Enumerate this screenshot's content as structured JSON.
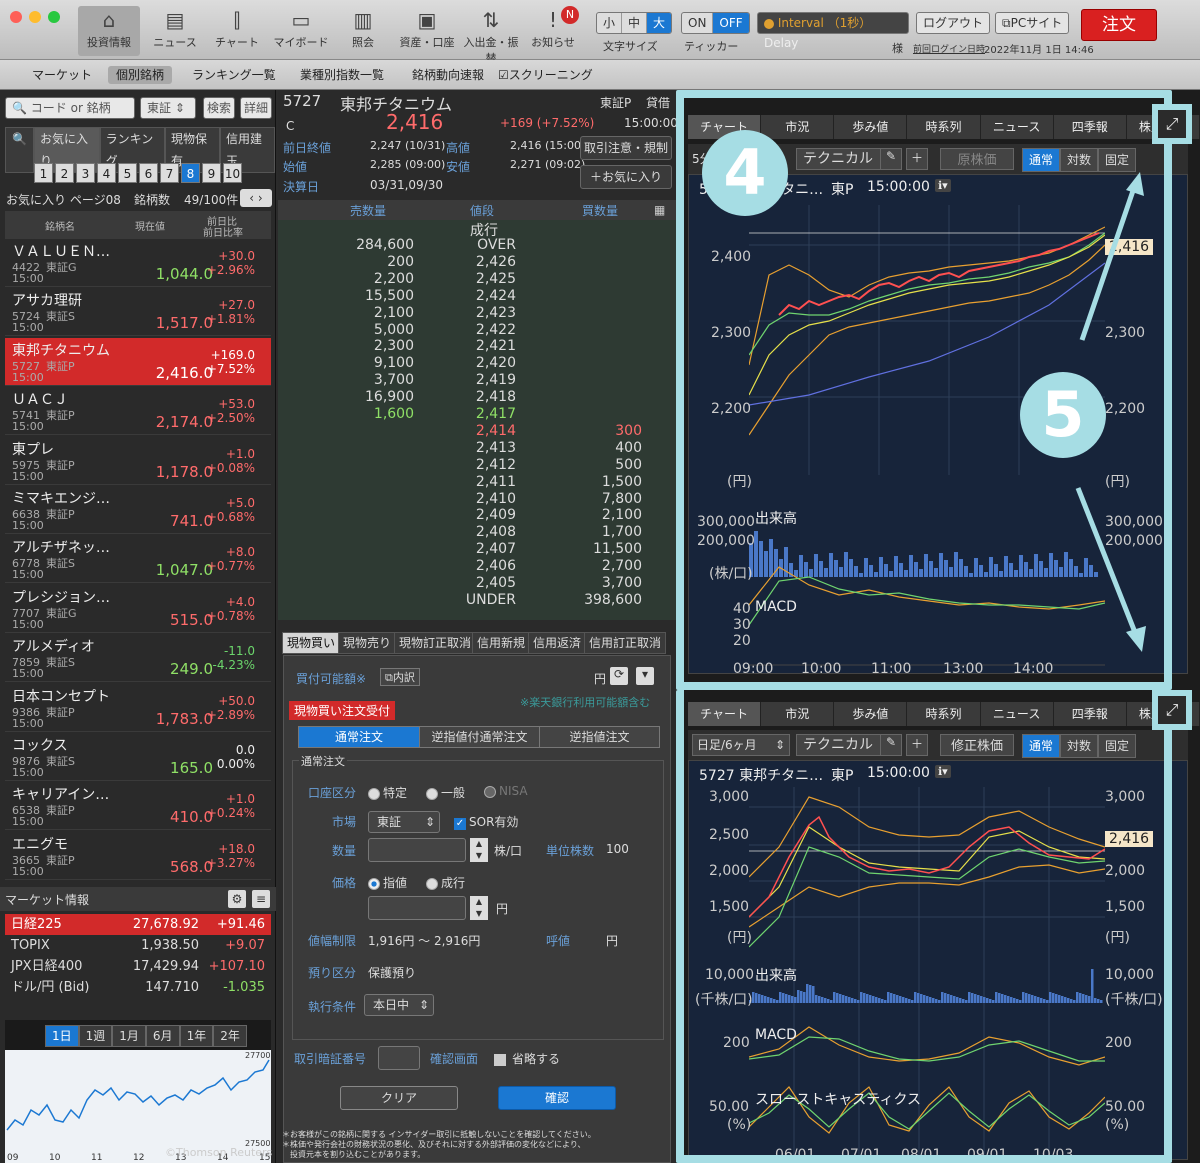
{
  "toolbar": {
    "buttons": [
      {
        "label": "投資情報",
        "icon": "home-icon",
        "glyph": "⌂"
      },
      {
        "label": "ニュース",
        "icon": "news-icon",
        "glyph": "▤"
      },
      {
        "label": "チャート",
        "icon": "candlestick-icon",
        "glyph": "⫿"
      },
      {
        "label": "マイボード",
        "icon": "myboard-icon",
        "glyph": "▭"
      },
      {
        "label": "照会",
        "icon": "book-icon",
        "glyph": "▥"
      },
      {
        "label": "資産・口座",
        "icon": "safe-icon",
        "glyph": "▣"
      },
      {
        "label": "入出金・振替",
        "icon": "transfer-icon",
        "glyph": "⇅"
      },
      {
        "label": "お知らせ",
        "icon": "notice-icon",
        "glyph": "!"
      }
    ],
    "notice_badge": "N",
    "font_size": {
      "options": [
        "小",
        "中",
        "大"
      ],
      "selected": "大",
      "label": "文字サイズ"
    },
    "ticker": {
      "options": [
        "ON",
        "OFF"
      ],
      "selected": "OFF",
      "label": "ティッカー"
    },
    "interval": {
      "label": "Interval",
      "sub": "（1秒）",
      "delay": "Delay"
    },
    "logout": "ログアウト",
    "pc_site": "PCサイト",
    "order": "注文",
    "user_suffix": "様",
    "last_login_label": "前回ログイン日時",
    "last_login": "2022年11月 1日 14:46"
  },
  "submenu": [
    "マーケット",
    "個別銘柄",
    "ランキング一覧",
    "業種別指数一覧",
    "銘柄動向速報",
    "☑スクリーニング"
  ],
  "submenu_selected": 1,
  "left": {
    "search_placeholder": "コード or 銘柄",
    "market": "東証",
    "search_btn": "検索",
    "detail_btn": "詳細",
    "tabs": [
      "お気に入り",
      "ランキング",
      "現物保有",
      "信用建玉"
    ],
    "pages": [
      "1",
      "2",
      "3",
      "4",
      "5",
      "6",
      "7",
      "8",
      "9",
      "10"
    ],
    "page_selected": 7,
    "fav_title": "お気に入り ページ08",
    "count_label": "銘柄数",
    "count": "49/100件",
    "col_name": "銘柄名",
    "col_price": "現在値",
    "col_change": "前日比",
    "col_change2": "前日比率",
    "stocks": [
      {
        "name": "ＶＡＬＵＥＮ…",
        "code": "4422",
        "mkt": "東証G",
        "time": "15:00",
        "price": "1,044.0",
        "chg": "+30.0",
        "pct": "+2.96%",
        "dir": "pos",
        "pcolor": "grn"
      },
      {
        "name": "アサカ理研",
        "code": "5724",
        "mkt": "東証S",
        "time": "15:00",
        "price": "1,517.0",
        "chg": "+27.0",
        "pct": "+1.81%",
        "dir": "pos",
        "pcolor": "pos"
      },
      {
        "name": "東邦チタニウム",
        "code": "5727",
        "mkt": "東証P",
        "time": "15:00",
        "price": "2,416.0",
        "chg": "+169.0",
        "pct": "+7.52%",
        "dir": "pos",
        "pcolor": "pos"
      },
      {
        "name": "ＵＡＣＪ",
        "code": "5741",
        "mkt": "東証P",
        "time": "15:00",
        "price": "2,174.0",
        "chg": "+53.0",
        "pct": "+2.50%",
        "dir": "pos",
        "pcolor": "pos"
      },
      {
        "name": "東プレ",
        "code": "5975",
        "mkt": "東証P",
        "time": "15:00",
        "price": "1,178.0",
        "chg": "+1.0",
        "pct": "+0.08%",
        "dir": "pos",
        "pcolor": "pos"
      },
      {
        "name": "ミマキエンジ…",
        "code": "6638",
        "mkt": "東証P",
        "time": "15:00",
        "price": "741.0",
        "chg": "+5.0",
        "pct": "+0.68%",
        "dir": "pos",
        "pcolor": "pos"
      },
      {
        "name": "アルチザネッ…",
        "code": "6778",
        "mkt": "東証S",
        "time": "15:00",
        "price": "1,047.0",
        "chg": "+8.0",
        "pct": "+0.77%",
        "dir": "pos",
        "pcolor": "grn"
      },
      {
        "name": "プレシジョン…",
        "code": "7707",
        "mkt": "東証G",
        "time": "15:00",
        "price": "515.0",
        "chg": "+4.0",
        "pct": "+0.78%",
        "dir": "pos",
        "pcolor": "pos"
      },
      {
        "name": "アルメディオ",
        "code": "7859",
        "mkt": "東証S",
        "time": "15:00",
        "price": "249.0",
        "chg": "-11.0",
        "pct": "-4.23%",
        "dir": "neg",
        "pcolor": "grn"
      },
      {
        "name": "日本コンセプト",
        "code": "9386",
        "mkt": "東証P",
        "time": "15:00",
        "price": "1,783.0",
        "chg": "+50.0",
        "pct": "+2.89%",
        "dir": "pos",
        "pcolor": "pos"
      },
      {
        "name": "コックス",
        "code": "9876",
        "mkt": "東証S",
        "time": "15:00",
        "price": "165.0",
        "chg": "0.0",
        "pct": "0.00%",
        "dir": "wht",
        "pcolor": "grn"
      },
      {
        "name": "キャリアイン…",
        "code": "6538",
        "mkt": "東証P",
        "time": "15:00",
        "price": "410.0",
        "chg": "+1.0",
        "pct": "+0.24%",
        "dir": "pos",
        "pcolor": "pos"
      },
      {
        "name": "エニグモ",
        "code": "3665",
        "mkt": "東証P",
        "time": "15:00",
        "price": "568.0",
        "chg": "+18.0",
        "pct": "+3.27%",
        "dir": "pos",
        "pcolor": "pos"
      }
    ],
    "market_title": "マーケット情報",
    "markets": [
      {
        "name": "日経225",
        "value": "27,678.92",
        "chg": "+91.46"
      },
      {
        "name": "TOPIX",
        "value": "1,938.50",
        "chg": "+9.07"
      },
      {
        "name": "JPX日経400",
        "value": "17,429.94",
        "chg": "+107.10"
      },
      {
        "name": "ドル/円 (Bid)",
        "value": "147.710",
        "chg": "-1.035"
      }
    ],
    "periods": [
      "1日",
      "1週",
      "1月",
      "6月",
      "1年",
      "2年"
    ],
    "period_selected": 0,
    "mini_y": [
      "27700",
      "27500"
    ],
    "mini_x": [
      "09",
      "10",
      "11",
      "12",
      "13",
      "14",
      "15"
    ],
    "copyright": "©Thomson Reuters"
  },
  "mid": {
    "code": "5727",
    "name": "東邦チタニウム",
    "market": "東証P",
    "margin": "貸借",
    "mark": "C",
    "price": "2,416",
    "change": "+169 (+7.52%)",
    "time": "15:00:00",
    "prev_close_label": "前日終値",
    "prev_close": "2,247 (10/31)",
    "high_label": "高値",
    "high": "2,416 (15:00)",
    "open_label": "始値",
    "open": "2,285 (09:00)",
    "low_label": "安値",
    "low": "2,271 (09:02)",
    "settle_label": "決算日",
    "settle": "03/31,09/30",
    "caution": "取引注意・規制",
    "fav_add": "＋お気に入り",
    "ob_headers": [
      "売数量",
      "値段",
      "買数量"
    ],
    "ob_top": "成行",
    "orderbook": [
      {
        "sell": "284,600",
        "price": "OVER",
        "buy": ""
      },
      {
        "sell": "200",
        "price": "2,426",
        "buy": ""
      },
      {
        "sell": "2,200",
        "price": "2,425",
        "buy": ""
      },
      {
        "sell": "15,500",
        "price": "2,424",
        "buy": ""
      },
      {
        "sell": "2,100",
        "price": "2,423",
        "buy": ""
      },
      {
        "sell": "5,000",
        "price": "2,422",
        "buy": ""
      },
      {
        "sell": "2,300",
        "price": "2,421",
        "buy": ""
      },
      {
        "sell": "9,100",
        "price": "2,420",
        "buy": ""
      },
      {
        "sell": "3,700",
        "price": "2,419",
        "buy": ""
      },
      {
        "sell": "16,900",
        "price": "2,418",
        "buy": ""
      },
      {
        "sell": "1,600",
        "price": "2,417",
        "buy": "",
        "hl": "g"
      },
      {
        "sell": "",
        "price": "2,414",
        "buy": "300",
        "hl": "r"
      },
      {
        "sell": "",
        "price": "2,413",
        "buy": "400"
      },
      {
        "sell": "",
        "price": "2,412",
        "buy": "500"
      },
      {
        "sell": "",
        "price": "2,411",
        "buy": "1,500"
      },
      {
        "sell": "",
        "price": "2,410",
        "buy": "7,800"
      },
      {
        "sell": "",
        "price": "2,409",
        "buy": "2,100"
      },
      {
        "sell": "",
        "price": "2,408",
        "buy": "1,700"
      },
      {
        "sell": "",
        "price": "2,407",
        "buy": "11,500"
      },
      {
        "sell": "",
        "price": "2,406",
        "buy": "2,700"
      },
      {
        "sell": "",
        "price": "2,405",
        "buy": "3,700"
      },
      {
        "sell": "",
        "price": "UNDER",
        "buy": "398,600"
      }
    ],
    "order_tabs": [
      "現物買い",
      "現物売り",
      "現物訂正取消",
      "信用新規",
      "信用返済",
      "信用訂正取消"
    ],
    "buying_power": "買付可能額※",
    "breakdown": "内訳",
    "yen": "円",
    "rakuten_note": "※楽天銀行利用可能額含む",
    "accept": "現物買い注文受付",
    "order_types": [
      "通常注文",
      "逆指値付通常注文",
      "逆指値注文"
    ],
    "section": "通常注文",
    "account_label": "口座区分",
    "accounts": [
      "特定",
      "一般",
      "NISA"
    ],
    "market_label": "市場",
    "market_value": "東証",
    "sor": "SOR有効",
    "qty_label": "数量",
    "qty_unit": "株/口",
    "unit_label": "単位株数",
    "unit": "100",
    "price_label": "価格",
    "price_opts": [
      "指値",
      "成行"
    ],
    "range_label": "値幅制限",
    "range": "1,916円 ～ 2,916円",
    "tick_label": "呼値",
    "deposit_label": "預り区分",
    "deposit": "保護預り",
    "cond_label": "執行条件",
    "cond": "本日中",
    "pin_label": "取引暗証番号",
    "confirm_screen": "確認画面",
    "omit": "省略する",
    "clear": "クリア",
    "confirm": "確認",
    "disclaimer": [
      "＊お客様がこの銘柄に関する インサイダー取引に抵触しないことを確認してください。",
      "＊株価や発行会社の財務状況の悪化、及びそれに対する外部評価の変化などにより、",
      "　投資元本を割り込むことがあります。"
    ]
  },
  "right": {
    "tabs": [
      "チャート",
      "市況",
      "歩み値",
      "時系列",
      "ニュース",
      "四季報",
      "株主優待"
    ],
    "chart1": {
      "period": "5分",
      "tech": "テクニカル",
      "adj": "原株価",
      "modes": [
        "通常",
        "対数",
        "固定"
      ],
      "title": "5727 東邦チタニ…",
      "mkt": "東P",
      "time": "15:00:00",
      "price_tag": "2,416",
      "y": [
        "2,400",
        "2,300",
        "2,200"
      ],
      "yunit": "(円)",
      "vol_label": "出来高",
      "vol_y": [
        "300,000",
        "200,000"
      ],
      "vol_unit": "(株/口)",
      "macd": "MACD",
      "macd_y": [
        "40",
        "30",
        "20"
      ],
      "x": [
        "09:00",
        "10:00",
        "11:00",
        "13:00",
        "14:00"
      ]
    },
    "chart2": {
      "period": "日足/6ヶ月",
      "tech": "テクニカル",
      "adj": "修正株価",
      "modes": [
        "通常",
        "対数",
        "固定"
      ],
      "title": "5727 東邦チタニ…",
      "mkt": "東P",
      "time": "15:00:00",
      "price_tag": "2,416",
      "y": [
        "3,000",
        "2,500",
        "2,000",
        "1,500"
      ],
      "yunit": "(円)",
      "vol_label": "出来高",
      "vol_y": [
        "10,000"
      ],
      "vol_unit": "(千株/口)",
      "macd": "MACD",
      "macd_y": [
        "200"
      ],
      "stoch": "スローストキャスティクス",
      "stoch_y": [
        "50.00"
      ],
      "stoch_unit": "(%)",
      "x": [
        "06/01",
        "07/01",
        "08/01",
        "09/01",
        "10/03"
      ]
    },
    "callout4": "4",
    "callout5": "5"
  },
  "colors": {
    "accent": "#1b78d2",
    "sell_red": "#d22a2a",
    "callout": "#a6dde4"
  }
}
